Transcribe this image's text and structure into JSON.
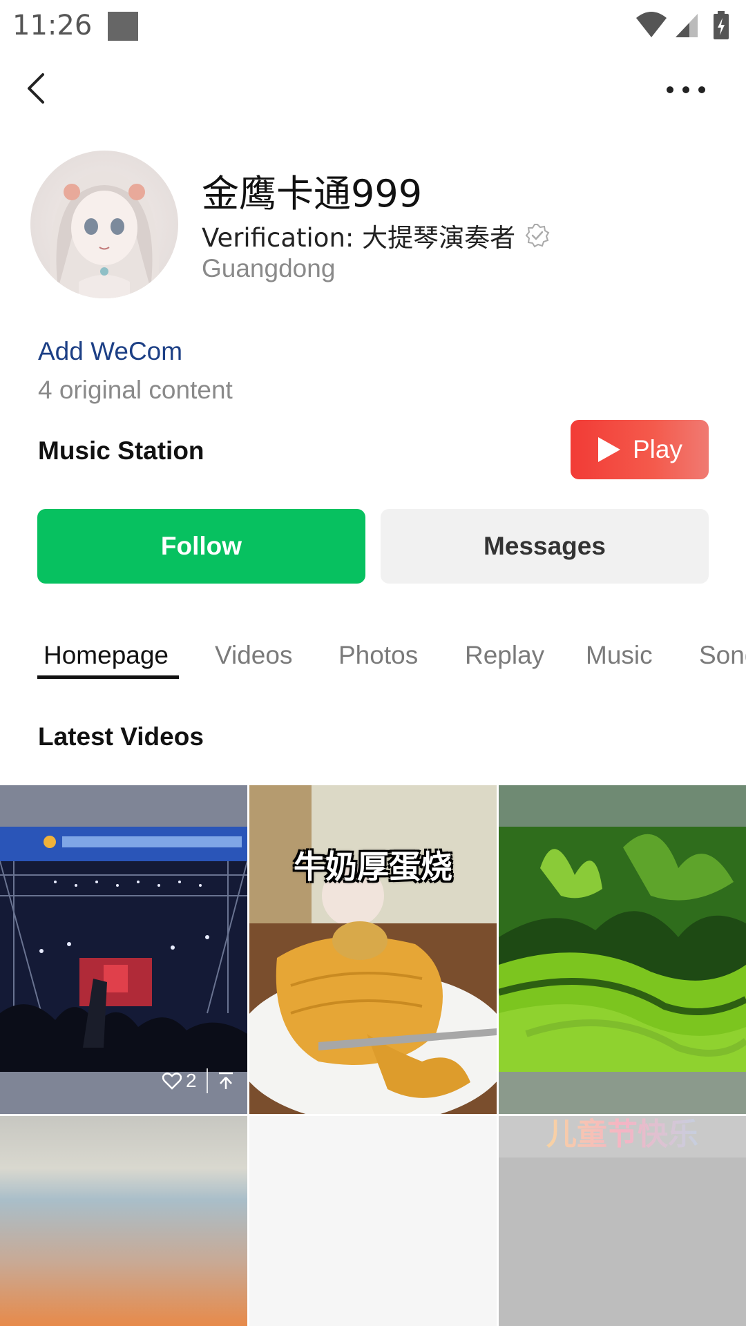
{
  "status_bar": {
    "time": "11:26"
  },
  "profile": {
    "name": "金鹰卡通999",
    "verification": "Verification: 大提琴演奏者",
    "region": "Guangdong"
  },
  "links": {
    "add_wecom": "Add WeCom",
    "original_count": "4 original content"
  },
  "music": {
    "title": "Music Station",
    "play_label": "Play"
  },
  "actions": {
    "follow_label": "Follow",
    "messages_label": "Messages"
  },
  "tabs": [
    {
      "label": "Homepage",
      "active": true
    },
    {
      "label": "Videos",
      "active": false
    },
    {
      "label": "Photos",
      "active": false
    },
    {
      "label": "Replay",
      "active": false
    },
    {
      "label": "Music",
      "active": false
    },
    {
      "label": "Songs",
      "active": false
    }
  ],
  "latest_videos": {
    "title": "Latest Videos",
    "items": [
      {
        "kind": "concert",
        "likes": "2"
      },
      {
        "kind": "food",
        "caption": "牛奶厚蛋烧"
      },
      {
        "kind": "landscape"
      },
      {
        "kind": "sunset"
      },
      {
        "kind": "blank"
      },
      {
        "kind": "festival",
        "caption": "儿童节快乐"
      }
    ]
  },
  "colors": {
    "follow_green": "#07c160",
    "play_red": "#f23b36",
    "link_blue": "#1c3f85"
  },
  "icons": [
    "back-arrow-icon",
    "more-dots-icon",
    "verified-badge-icon",
    "play-triangle-icon",
    "heart-icon",
    "share-icon",
    "wifi-icon",
    "signal-icon",
    "battery-icon"
  ]
}
